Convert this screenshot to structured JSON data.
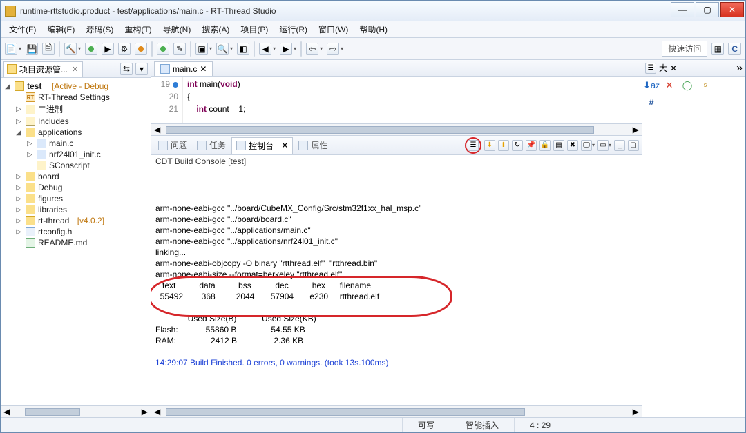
{
  "title": "runtime-rttstudio.product - test/applications/main.c - RT-Thread Studio",
  "menus": [
    "文件(F)",
    "编辑(E)",
    "源码(S)",
    "重构(T)",
    "导航(N)",
    "搜索(A)",
    "项目(P)",
    "运行(R)",
    "窗口(W)",
    "帮助(H)"
  ],
  "quick": "快速访问",
  "perspective_c": "C",
  "project_panel": {
    "title": "项目资源管..."
  },
  "tree": {
    "root": "test",
    "root_tag": "[Active - Debug",
    "rt": "RT-Thread Settings",
    "bin": "二进制",
    "includes": "Includes",
    "apps": "applications",
    "mainc": "main.c",
    "nrf": "nrf24l01_init.c",
    "scons": "SConscript",
    "board": "board",
    "debug": "Debug",
    "figures": "figures",
    "libraries": "libraries",
    "rtthread": "rt-thread",
    "rtthread_tag": "[v4.0.2]",
    "rtcfg": "rtconfig.h",
    "readme": "README.md"
  },
  "editor": {
    "tab": "main.c",
    "g19": "19",
    "g20": "20",
    "g21": "21",
    "l1_kw1": "int",
    "l1_fn": " main(",
    "l1_kw2": "void",
    "l1_end": ")",
    "l2": "{",
    "l3_kw": "int",
    "l3_rest": " count = 1;"
  },
  "bottom": {
    "problems": "问题",
    "tasks": "任务",
    "console": "控制台",
    "props": "属性",
    "hdr": "CDT Build Console [test]",
    "lines": [
      "arm-none-eabi-gcc \"../board/CubeMX_Config/Src/stm32f1xx_hal_msp.c\"",
      "arm-none-eabi-gcc \"../board/board.c\"",
      "arm-none-eabi-gcc \"../applications/main.c\"",
      "arm-none-eabi-gcc \"../applications/nrf24l01_init.c\"",
      "linking...",
      "arm-none-eabi-objcopy -O binary \"rtthread.elf\"  \"rtthread.bin\"",
      "arm-none-eabi-size --format=berkeley \"rtthread.elf\"",
      "   text\t   data\t    bss\t    dec\t    hex\tfilename",
      "  55492\t    368\t   2044\t  57904\t   e230\trtthread.elf",
      "",
      "              Used Size(B)           Used Size(KB)",
      "Flash:            55860 B               54.55 KB",
      "RAM:               2412 B                2.36 KB",
      ""
    ],
    "finish": "14:29:07 Build Finished. 0 errors, 0 warnings. (took 13s.100ms)"
  },
  "outline": {
    "title": "大"
  },
  "status": {
    "writable": "可写",
    "insert": "智能插入",
    "pos": "4 : 29"
  }
}
